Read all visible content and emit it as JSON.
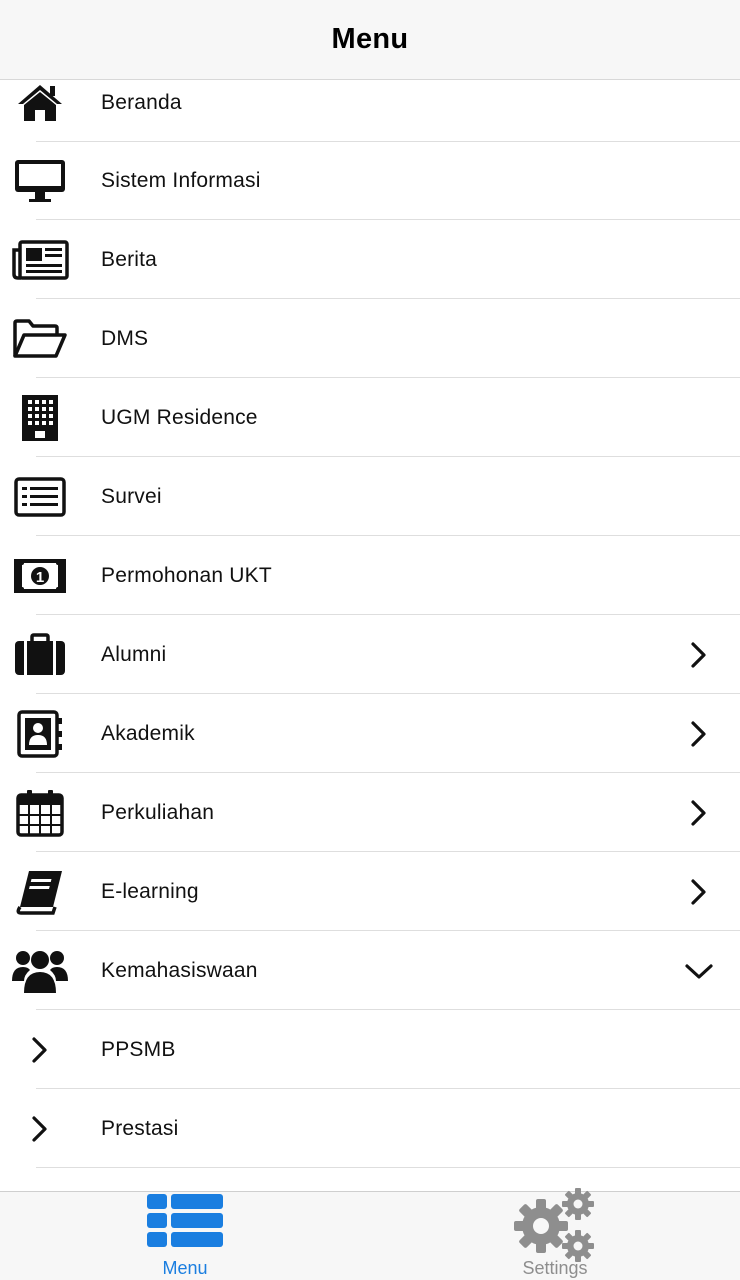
{
  "navbar": {
    "title": "Menu"
  },
  "menu_items": [
    {
      "label": "Beranda",
      "icon": "home-icon",
      "accessory": ""
    },
    {
      "label": "Sistem Informasi",
      "icon": "desktop-icon",
      "accessory": ""
    },
    {
      "label": "Berita",
      "icon": "newspaper-icon",
      "accessory": ""
    },
    {
      "label": "DMS",
      "icon": "folder-open-icon",
      "accessory": ""
    },
    {
      "label": "UGM Residence",
      "icon": "building-icon",
      "accessory": ""
    },
    {
      "label": "Survei",
      "icon": "list-icon",
      "accessory": ""
    },
    {
      "label": "Permohonan UKT",
      "icon": "money-icon",
      "accessory": ""
    },
    {
      "label": "Alumni",
      "icon": "briefcase-icon",
      "accessory": "chevron-right"
    },
    {
      "label": "Akademik",
      "icon": "contact-book-icon",
      "accessory": "chevron-right"
    },
    {
      "label": "Perkuliahan",
      "icon": "calendar-icon",
      "accessory": "chevron-right"
    },
    {
      "label": "E-learning",
      "icon": "book-icon",
      "accessory": "chevron-right"
    },
    {
      "label": "Kemahasiswaan",
      "icon": "users-icon",
      "accessory": "chevron-down"
    },
    {
      "label": "PPSMB",
      "icon": "chevron-right-icon",
      "accessory": ""
    },
    {
      "label": "Prestasi",
      "icon": "chevron-right-icon",
      "accessory": ""
    }
  ],
  "tabbar": {
    "menu_label": "Menu",
    "settings_label": "Settings",
    "active_color": "#1a7ee0",
    "inactive_color": "#8e8e8e"
  }
}
